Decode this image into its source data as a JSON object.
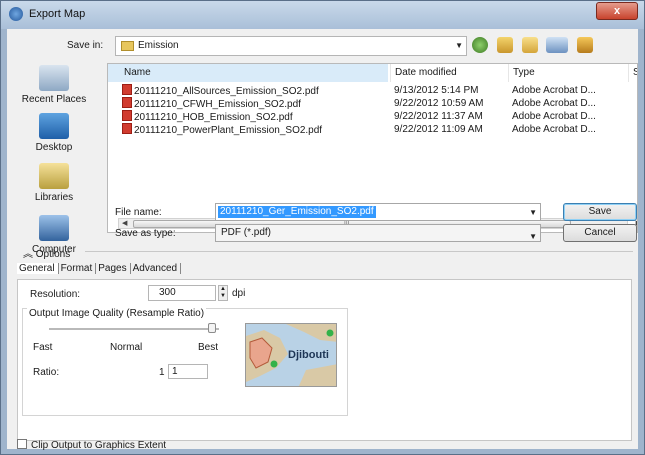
{
  "title": "Export Map",
  "close_label": "x",
  "save_in": {
    "label": "Save in:",
    "value": "Emission"
  },
  "places": [
    "Recent Places",
    "Desktop",
    "Libraries",
    "Computer"
  ],
  "columns": {
    "name": "Name",
    "date": "Date modified",
    "type": "Type",
    "size": "Siz"
  },
  "files": [
    {
      "name": "20111210_AllSources_Emission_SO2.pdf",
      "date": "9/13/2012 5:14 PM",
      "type": "Adobe Acrobat D..."
    },
    {
      "name": "20111210_CFWH_Emission_SO2.pdf",
      "date": "9/22/2012 10:59 AM",
      "type": "Adobe Acrobat D..."
    },
    {
      "name": "20111210_HOB_Emission_SO2.pdf",
      "date": "9/22/2012 11:37 AM",
      "type": "Adobe Acrobat D..."
    },
    {
      "name": "20111210_PowerPlant_Emission_SO2.pdf",
      "date": "9/22/2012 11:09 AM",
      "type": "Adobe Acrobat D..."
    }
  ],
  "scroll_grip": "|||",
  "file_name": {
    "label": "File name:",
    "value": "20111210_Ger_Emission_SO2.pdf"
  },
  "save_type": {
    "label": "Save as type:",
    "value": "PDF (*.pdf)"
  },
  "buttons": {
    "save": "Save",
    "cancel": "Cancel"
  },
  "options_label": "Options",
  "tabs": [
    "General",
    "Format",
    "Pages",
    "Advanced"
  ],
  "resolution": {
    "label": "Resolution:",
    "value": "300",
    "unit": "dpi"
  },
  "quality": {
    "title": "Output Image Quality (Resample Ratio)",
    "fast": "Fast",
    "normal": "Normal",
    "best": "Best",
    "ratio_label": "Ratio:",
    "ratio_left": "1 :",
    "ratio_value": "1",
    "preview_label": "Djibouti"
  },
  "clip_label": "Clip Output to Graphics Extent",
  "icons": {
    "window": "map-export-icon",
    "folder": "folder-icon",
    "back": "back-icon",
    "up": "up-folder-icon",
    "new_folder": "new-folder-icon",
    "views": "views-icon",
    "home": "home-icon"
  },
  "colors": {
    "selection": "#3399ff",
    "titlebar": "#a9bfd8",
    "close": "#c8432d"
  }
}
